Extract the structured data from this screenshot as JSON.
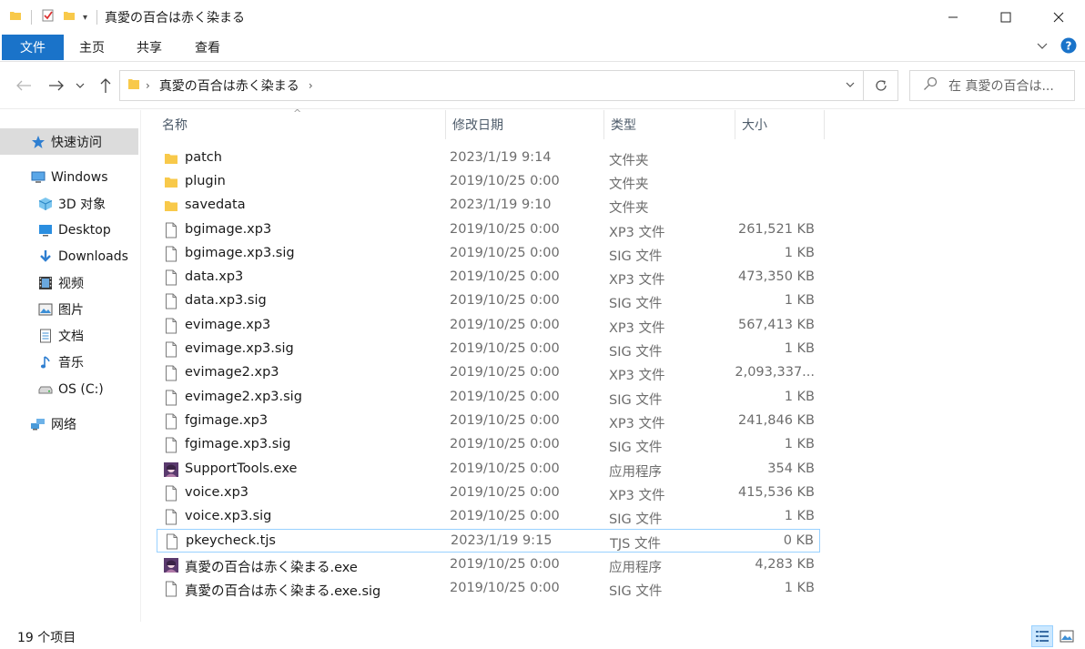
{
  "window": {
    "title": "真愛の百合は赤く染まる"
  },
  "ribbon": {
    "tabs": [
      {
        "label": "文件",
        "active": true
      },
      {
        "label": "主页",
        "active": false
      },
      {
        "label": "共享",
        "active": false
      },
      {
        "label": "查看",
        "active": false
      }
    ]
  },
  "address": {
    "crumbs": [
      "真愛の百合は赤く染まる"
    ]
  },
  "search": {
    "placeholder": "在 真愛の百合は..."
  },
  "sidebar": {
    "items": [
      {
        "label": "快速访问",
        "icon": "star-icon",
        "selected": true
      },
      {
        "label": "Windows",
        "icon": "computer-icon",
        "selected": false
      },
      {
        "label": "3D 对象",
        "icon": "cube-icon",
        "selected": false
      },
      {
        "label": "Desktop",
        "icon": "desktop-icon",
        "selected": false
      },
      {
        "label": "Downloads",
        "icon": "download-icon",
        "selected": false
      },
      {
        "label": "视频",
        "icon": "video-icon",
        "selected": false
      },
      {
        "label": "图片",
        "icon": "picture-icon",
        "selected": false
      },
      {
        "label": "文档",
        "icon": "document-icon",
        "selected": false
      },
      {
        "label": "音乐",
        "icon": "music-icon",
        "selected": false
      },
      {
        "label": "OS (C:)",
        "icon": "drive-icon",
        "selected": false
      },
      {
        "label": "网络",
        "icon": "network-icon",
        "selected": false
      }
    ]
  },
  "columns": {
    "name": "名称",
    "date": "修改日期",
    "type": "类型",
    "size": "大小"
  },
  "files": [
    {
      "name": "patch",
      "date": "2023/1/19 9:14",
      "type": "文件夹",
      "size": "",
      "icon": "folder-icon"
    },
    {
      "name": "plugin",
      "date": "2019/10/25 0:00",
      "type": "文件夹",
      "size": "",
      "icon": "folder-icon"
    },
    {
      "name": "savedata",
      "date": "2023/1/19 9:10",
      "type": "文件夹",
      "size": "",
      "icon": "folder-icon"
    },
    {
      "name": "bgimage.xp3",
      "date": "2019/10/25 0:00",
      "type": "XP3 文件",
      "size": "261,521 KB",
      "icon": "file-icon"
    },
    {
      "name": "bgimage.xp3.sig",
      "date": "2019/10/25 0:00",
      "type": "SIG 文件",
      "size": "1 KB",
      "icon": "file-icon"
    },
    {
      "name": "data.xp3",
      "date": "2019/10/25 0:00",
      "type": "XP3 文件",
      "size": "473,350 KB",
      "icon": "file-icon"
    },
    {
      "name": "data.xp3.sig",
      "date": "2019/10/25 0:00",
      "type": "SIG 文件",
      "size": "1 KB",
      "icon": "file-icon"
    },
    {
      "name": "evimage.xp3",
      "date": "2019/10/25 0:00",
      "type": "XP3 文件",
      "size": "567,413 KB",
      "icon": "file-icon"
    },
    {
      "name": "evimage.xp3.sig",
      "date": "2019/10/25 0:00",
      "type": "SIG 文件",
      "size": "1 KB",
      "icon": "file-icon"
    },
    {
      "name": "evimage2.xp3",
      "date": "2019/10/25 0:00",
      "type": "XP3 文件",
      "size": "2,093,337...",
      "icon": "file-icon"
    },
    {
      "name": "evimage2.xp3.sig",
      "date": "2019/10/25 0:00",
      "type": "SIG 文件",
      "size": "1 KB",
      "icon": "file-icon"
    },
    {
      "name": "fgimage.xp3",
      "date": "2019/10/25 0:00",
      "type": "XP3 文件",
      "size": "241,846 KB",
      "icon": "file-icon"
    },
    {
      "name": "fgimage.xp3.sig",
      "date": "2019/10/25 0:00",
      "type": "SIG 文件",
      "size": "1 KB",
      "icon": "file-icon"
    },
    {
      "name": "SupportTools.exe",
      "date": "2019/10/25 0:00",
      "type": "应用程序",
      "size": "354 KB",
      "icon": "app-icon"
    },
    {
      "name": "voice.xp3",
      "date": "2019/10/25 0:00",
      "type": "XP3 文件",
      "size": "415,536 KB",
      "icon": "file-icon"
    },
    {
      "name": "voice.xp3.sig",
      "date": "2019/10/25 0:00",
      "type": "SIG 文件",
      "size": "1 KB",
      "icon": "file-icon"
    },
    {
      "name": "pkeycheck.tjs",
      "date": "2023/1/19 9:15",
      "type": "TJS 文件",
      "size": "0 KB",
      "icon": "file-icon",
      "focused": true
    },
    {
      "name": "真愛の百合は赤く染まる.exe",
      "date": "2019/10/25 0:00",
      "type": "应用程序",
      "size": "4,283 KB",
      "icon": "app-icon"
    },
    {
      "name": "真愛の百合は赤く染まる.exe.sig",
      "date": "2019/10/25 0:00",
      "type": "SIG 文件",
      "size": "1 KB",
      "icon": "file-icon"
    }
  ],
  "status": {
    "item_count": "19 个项目"
  },
  "colors": {
    "accent": "#1a73c9",
    "folder": "#f8c94a",
    "selection": "#dcdcdc",
    "focus_border": "#99d1ff"
  }
}
